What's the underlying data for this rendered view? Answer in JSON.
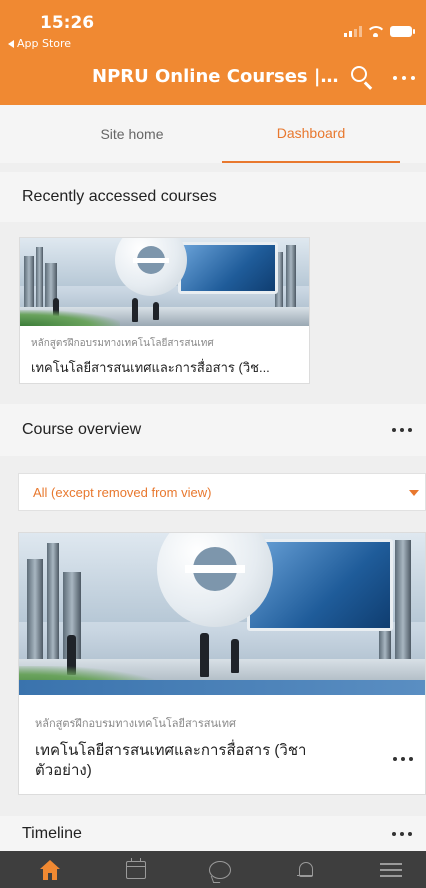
{
  "status_bar": {
    "time": "15:26",
    "back_label": "App Store"
  },
  "header": {
    "title": "NPRU Online Courses | NP...",
    "search_icon": "search-icon",
    "more_icon": "more-icon"
  },
  "tabs": [
    {
      "label": "Site home",
      "active": false
    },
    {
      "label": "Dashboard",
      "active": true
    }
  ],
  "recent": {
    "heading": "Recently accessed courses",
    "course": {
      "category": "หลักสูตรฝึกอบรมทางเทคโนโลยีสารสนเทศ",
      "name": "เทคโนโลยีสารสนเทศและการสื่อสาร (วิช..."
    }
  },
  "overview": {
    "heading": "Course overview",
    "filter": "All (except removed from view)",
    "course": {
      "category": "หลักสูตรฝึกอบรมทางเทคโนโลยีสารสนเทศ",
      "name_line1": "เทคโนโลยีสารสนเทศและการสื่อสาร (วิชา",
      "name_line2": "ตัวอย่าง)"
    }
  },
  "timeline": {
    "heading": "Timeline"
  },
  "bottom_nav": [
    "home-icon",
    "calendar-icon",
    "messages-icon",
    "notifications-icon",
    "menu-icon"
  ],
  "colors": {
    "accent": "#f08932",
    "nav_background": "#3e3e3e",
    "page_background": "#efefef"
  }
}
